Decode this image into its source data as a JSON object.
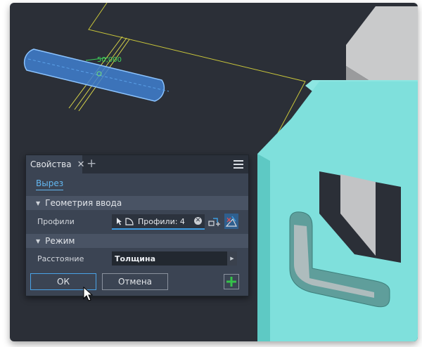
{
  "viewport": {
    "dimension_label": "50,000"
  },
  "panel": {
    "tab_title": "Свойства",
    "tab_close": "✕",
    "tab_add": "+",
    "subtab": "Вырез",
    "section_input_geometry": "Геометрия ввода",
    "profiles_label": "Профили",
    "profiles_value": "Профили: 4",
    "section_mode": "Режим",
    "distance_label": "Расстояние",
    "distance_value": "Толщина",
    "ok_label": "ОК",
    "cancel_label": "Отмена"
  },
  "colors": {
    "panel_bg": "#3b4453",
    "accent": "#3d9be0",
    "sheet_metal": "#7fe0dc",
    "sketch_line": "#c9c63a",
    "add_green": "#35c24a"
  },
  "icons": [
    "close-icon",
    "plus-icon",
    "hamburger-menu-icon",
    "collapse-triangle-icon",
    "select-cursor-icon",
    "profile-shape-icon",
    "clear-icon",
    "sketch-tool-icon",
    "filter-tool-icon",
    "dropdown-arrow-icon",
    "add-plus-icon",
    "mouse-pointer-icon"
  ]
}
